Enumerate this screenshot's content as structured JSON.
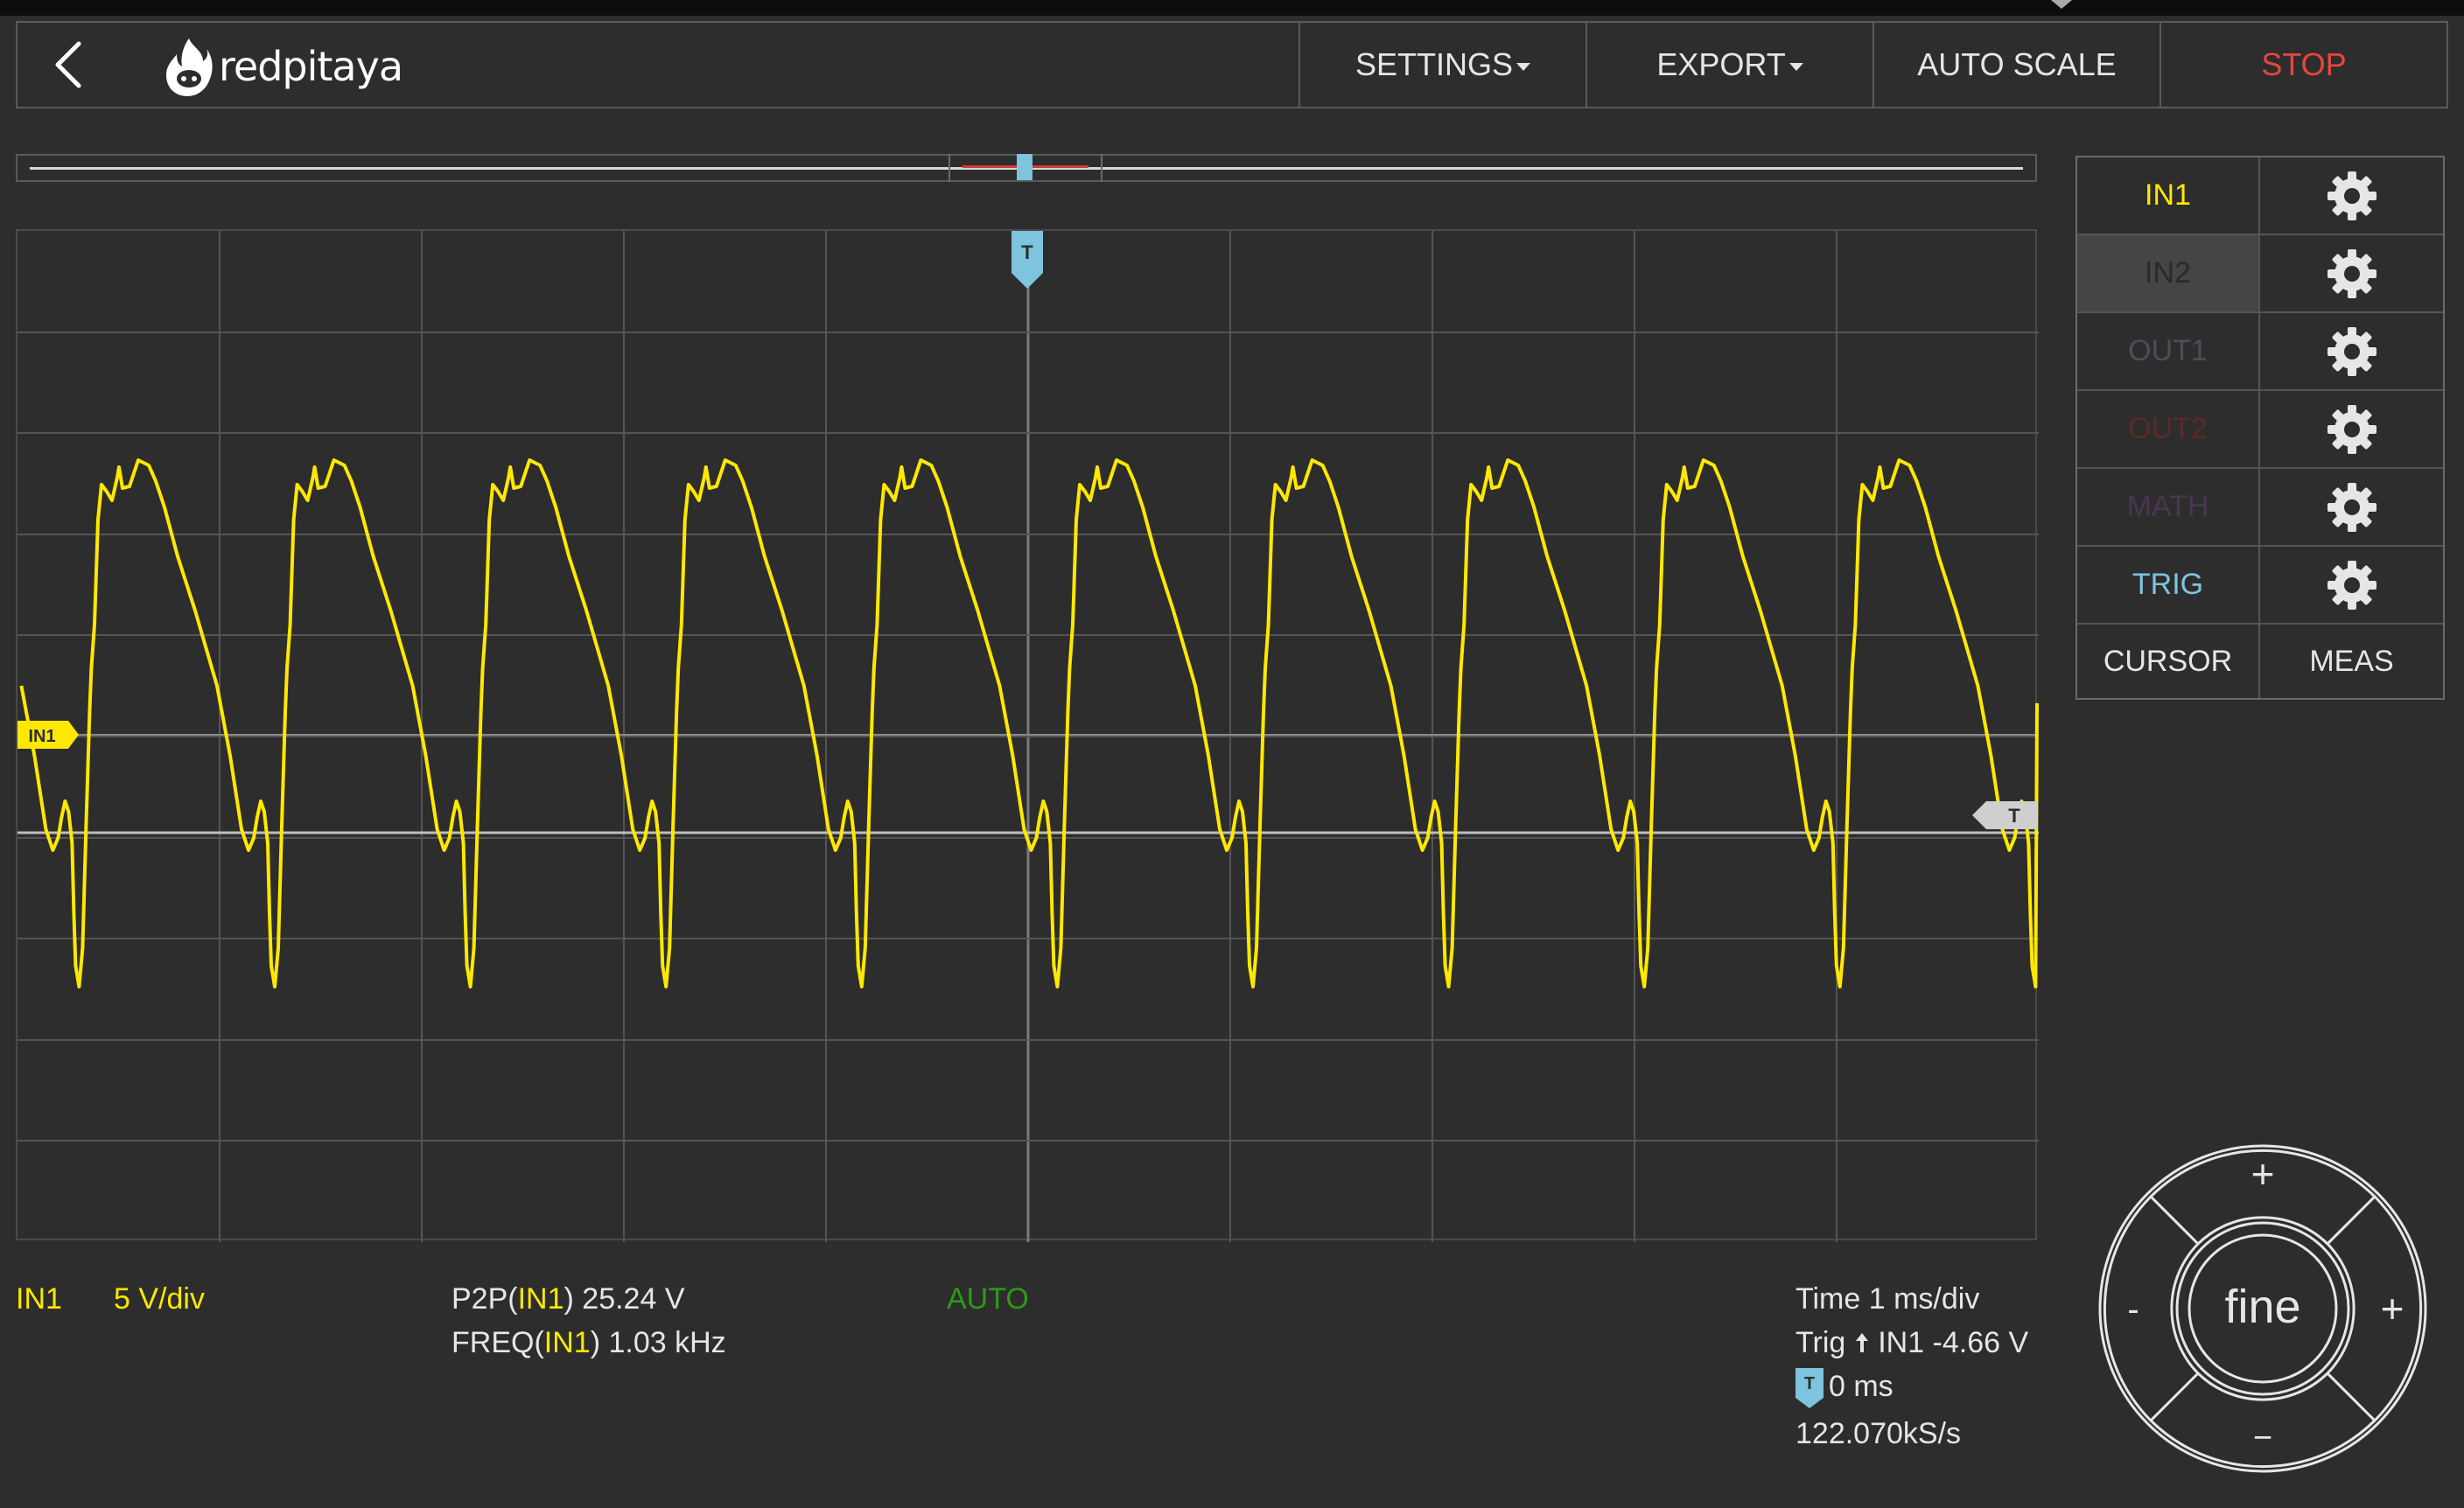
{
  "header": {
    "logo_text": "redpitaya",
    "menu": [
      {
        "label": "SETTINGS",
        "dropdown": true,
        "color": "#e6e6e6"
      },
      {
        "label": "EXPORT",
        "dropdown": true,
        "color": "#e6e6e6"
      },
      {
        "label": "AUTO SCALE",
        "dropdown": false,
        "color": "#e6e6e6"
      },
      {
        "label": "STOP",
        "dropdown": false,
        "color": "#e8453c"
      }
    ]
  },
  "channels": [
    {
      "label": "IN1",
      "color": "#ffe800",
      "selected": false
    },
    {
      "label": "IN2",
      "color": "#2a2a2a",
      "selected": true
    },
    {
      "label": "OUT1",
      "color": "#4a4e5a",
      "selected": false
    },
    {
      "label": "OUT2",
      "color": "#5a2a2a",
      "selected": false
    },
    {
      "label": "MATH",
      "color": "#4a3550",
      "selected": false
    },
    {
      "label": "TRIG",
      "color": "#7ec4de",
      "selected": false
    }
  ],
  "bottom_buttons": {
    "cursor": "CURSOR",
    "meas": "MEAS"
  },
  "scope": {
    "trigger_marker": "T",
    "channel_marker": "IN1",
    "trace_color": "#ffe800",
    "grid_color": "#555555"
  },
  "status": {
    "channel": "IN1",
    "scale": "5 V/div",
    "p2p_prefix": "P2P(",
    "p2p_channel": "IN1",
    "p2p_value": ") 25.24 V",
    "freq_prefix": "FREQ(",
    "freq_channel": "IN1",
    "freq_value": ") 1.03 kHz",
    "mode": "AUTO",
    "time": "Time 1 ms/div",
    "trig_prefix": "Trig",
    "trig_value": "IN1 -4.66 V",
    "trig_offset": "0 ms",
    "sample_rate": "122.070kS/s"
  },
  "dpad": {
    "center": "fine",
    "up": "+",
    "down": "−",
    "left": "-",
    "right": "+"
  }
}
